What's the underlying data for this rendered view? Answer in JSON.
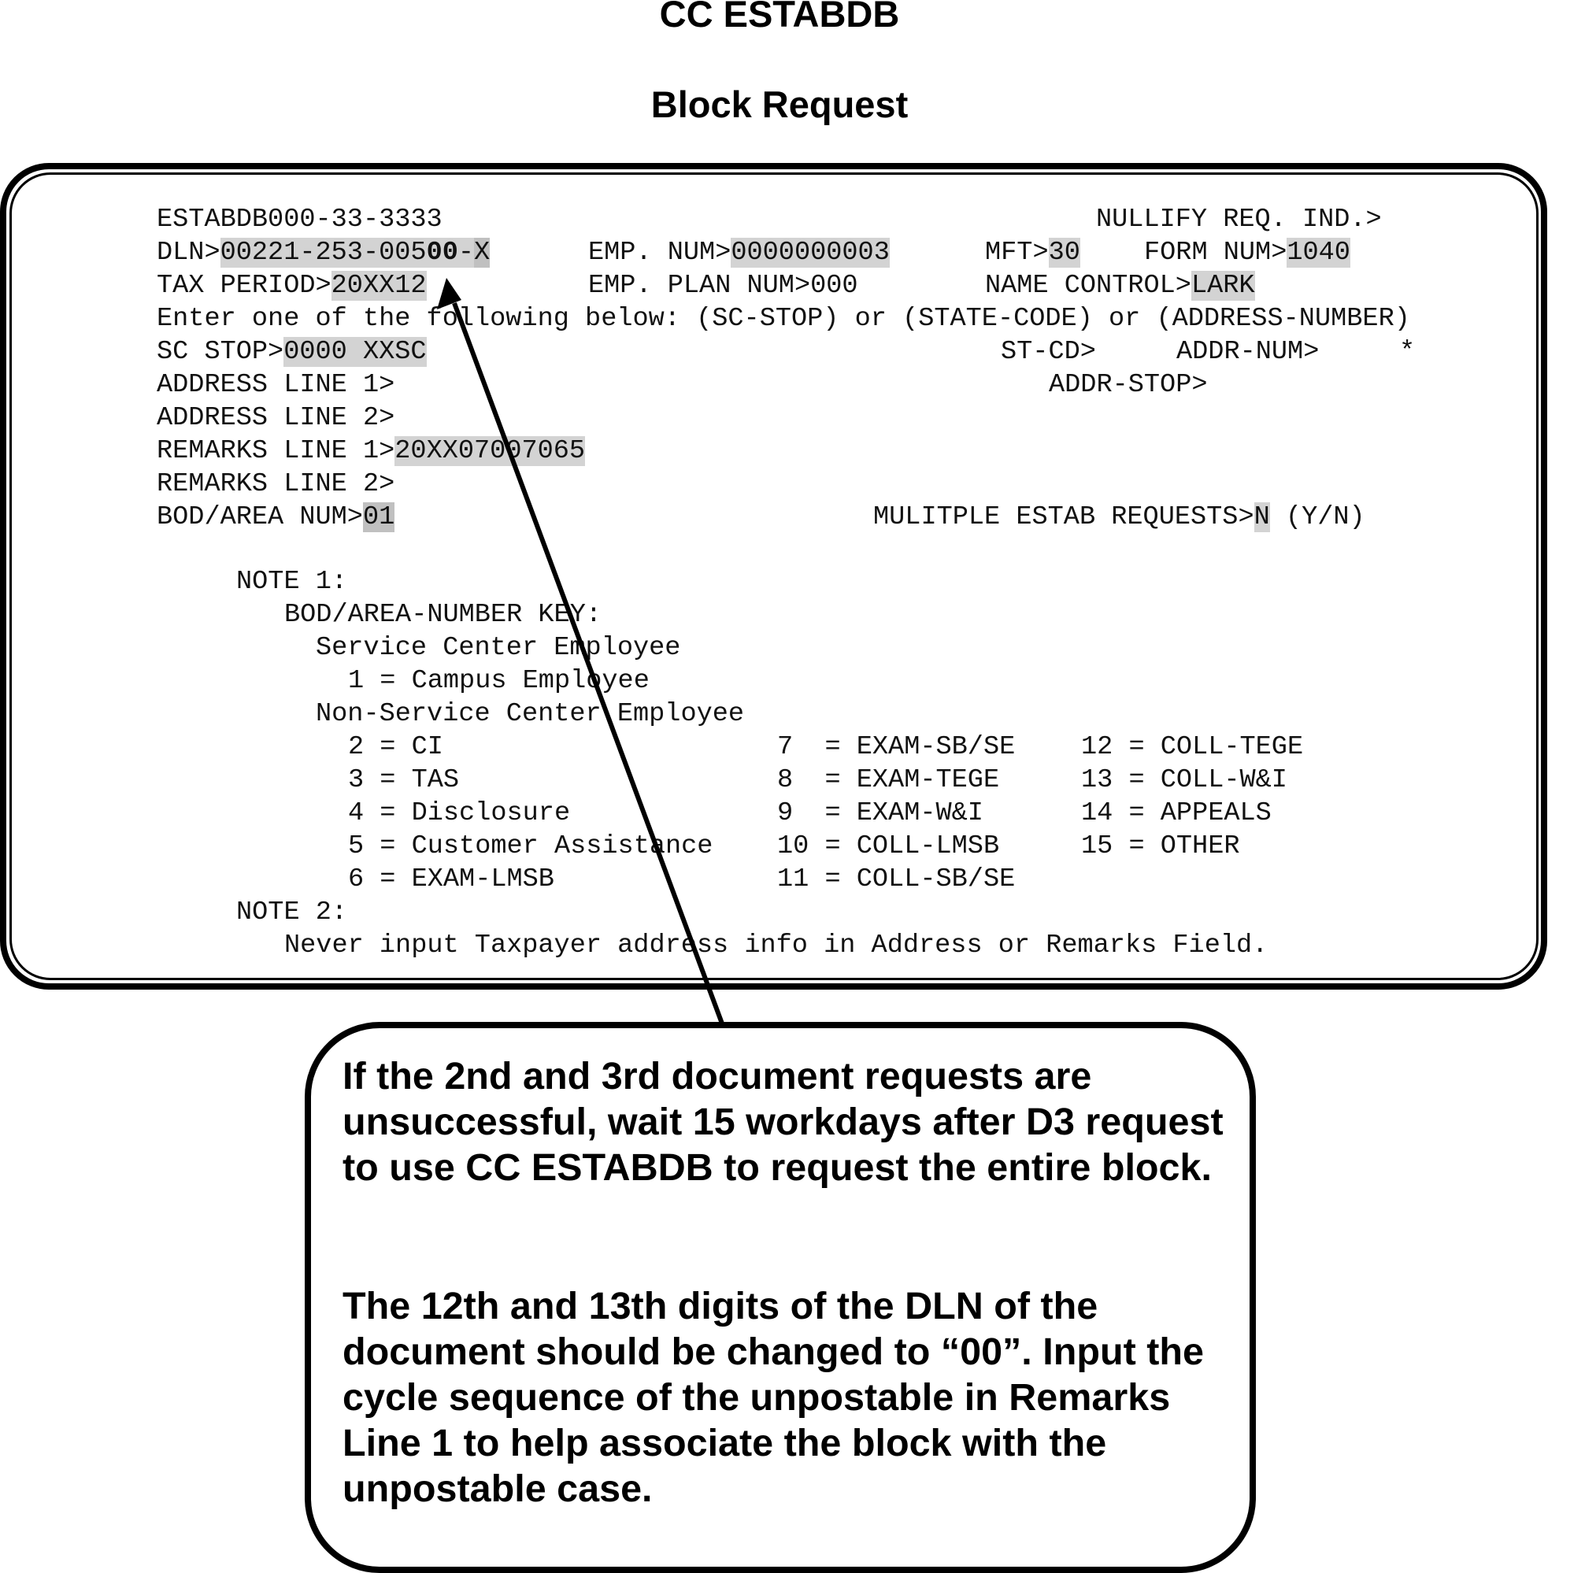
{
  "titles": {
    "command": "CC ESTABDB",
    "subtitle": "Block Request"
  },
  "screen": {
    "header_id": "ESTABDB000-33-3333",
    "nullify_label": "NULLIFY REQ. IND.>",
    "dln": {
      "label": "DLN>",
      "value_prefix": "00221-253-005",
      "value_bold": "00",
      "value_dash": "-",
      "value_suffix": "X"
    },
    "emp_num": {
      "label": "EMP. NUM>",
      "value": "0000000003"
    },
    "mft": {
      "label": "MFT>",
      "value": "30"
    },
    "form_num": {
      "label": "FORM NUM>",
      "value": "1040"
    },
    "tax_period": {
      "label": "TAX PERIOD>",
      "value": "20XX12"
    },
    "emp_plan_num": {
      "label": "EMP. PLAN NUM>",
      "value": "000"
    },
    "name_control": {
      "label": "NAME CONTROL>",
      "value": "LARK"
    },
    "instruction": "Enter one of the following below: (SC-STOP) or (STATE-CODE) or (ADDRESS-NUMBER)",
    "sc_stop": {
      "label": "SC STOP>",
      "value": "0000 XXSC"
    },
    "st_cd": {
      "label": "ST-CD>"
    },
    "addr_num": {
      "label": "ADDR-NUM>"
    },
    "asterisk": "*",
    "address_line_1": {
      "label": "ADDRESS LINE 1>"
    },
    "addr_stop": {
      "label": "ADDR-STOP>"
    },
    "address_line_2": {
      "label": "ADDRESS LINE 2>"
    },
    "remarks_line_1": {
      "label": "REMARKS LINE 1>",
      "value": "20XX07007065"
    },
    "remarks_line_2": {
      "label": "REMARKS LINE 2>"
    },
    "bod_area_num": {
      "label": "BOD/AREA NUM>",
      "value": "01"
    },
    "multiple_estab": {
      "label": "MULITPLE ESTAB REQUESTS>",
      "value": "N",
      "hint": "(Y/N)"
    },
    "note1": {
      "heading": "NOTE 1:",
      "key_heading": "BOD/AREA-NUMBER KEY:",
      "service_center": "Service Center Employee",
      "service_items": [
        "1 = Campus Employee"
      ],
      "non_service_center": "Non-Service Center Employee",
      "col1": [
        "2 = CI",
        "3 = TAS",
        "4 = Disclosure",
        "5 = Customer Assistance",
        "6 = EXAM-LMSB"
      ],
      "col2": [
        "7  = EXAM-SB/SE",
        "8  = EXAM-TEGE",
        "9  = EXAM-W&I",
        "10 = COLL-LMSB",
        "11 = COLL-SB/SE"
      ],
      "col3": [
        "12 = COLL-TEGE",
        "13 = COLL-W&I",
        "14 = APPEALS",
        "15 = OTHER"
      ]
    },
    "note2": {
      "heading": "NOTE 2:",
      "text": "Never input Taxpayer address info in Address or Remarks Field."
    }
  },
  "callout": {
    "paragraph1": "If the 2nd and 3rd document requests are unsuccessful, wait 15 workdays after D3 request to use CC ESTABDB to request the entire block.",
    "paragraph2": "The 12th and 13th digits of the DLN of the document should be changed to “00”. Input the cycle sequence of the unpostable in Remarks Line 1 to help associate the block with the unpostable case."
  },
  "colors": {
    "field_highlight": "#d3d3d3",
    "field_highlight_dark": "#c0c0c0",
    "ink": "#000000"
  }
}
